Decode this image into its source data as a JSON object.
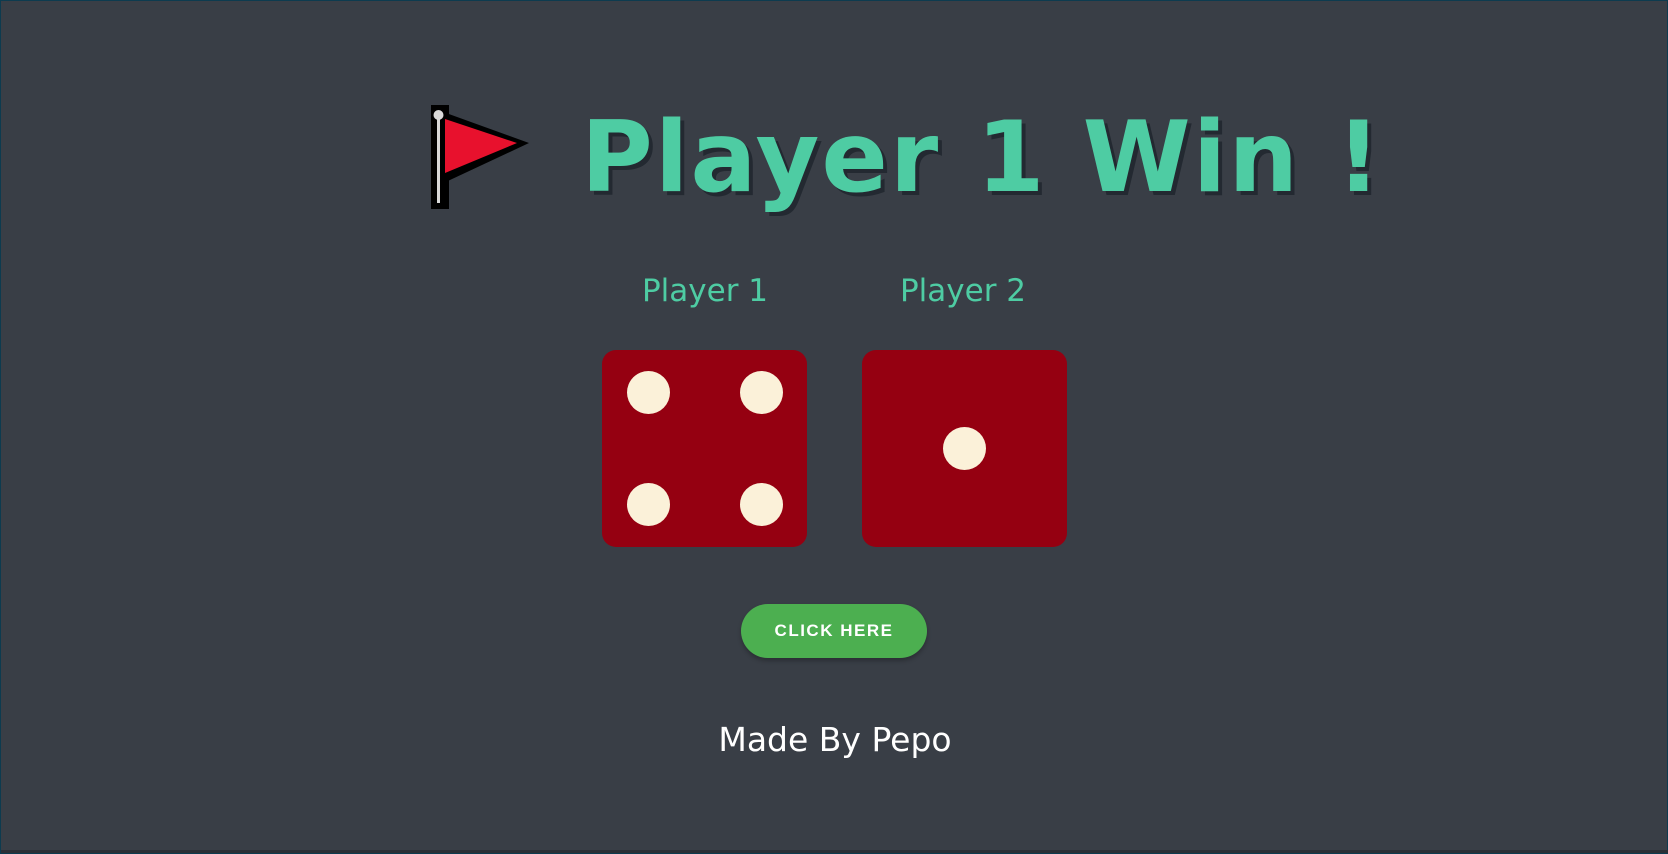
{
  "page": {
    "title": "Player 1 Win !",
    "flag_icon": "red-triangular-flag-icon"
  },
  "players": [
    {
      "label": "Player 1",
      "die_value": 4
    },
    {
      "label": "Player 2",
      "die_value": 1
    }
  ],
  "button": {
    "label": "CLICK HERE"
  },
  "footer": {
    "credit": "Made By Pepo"
  },
  "colors": {
    "background": "#393e46",
    "accent": "#4ecca3",
    "die": "#950011",
    "pip": "#fbf1d9",
    "button": "#4caf50"
  }
}
